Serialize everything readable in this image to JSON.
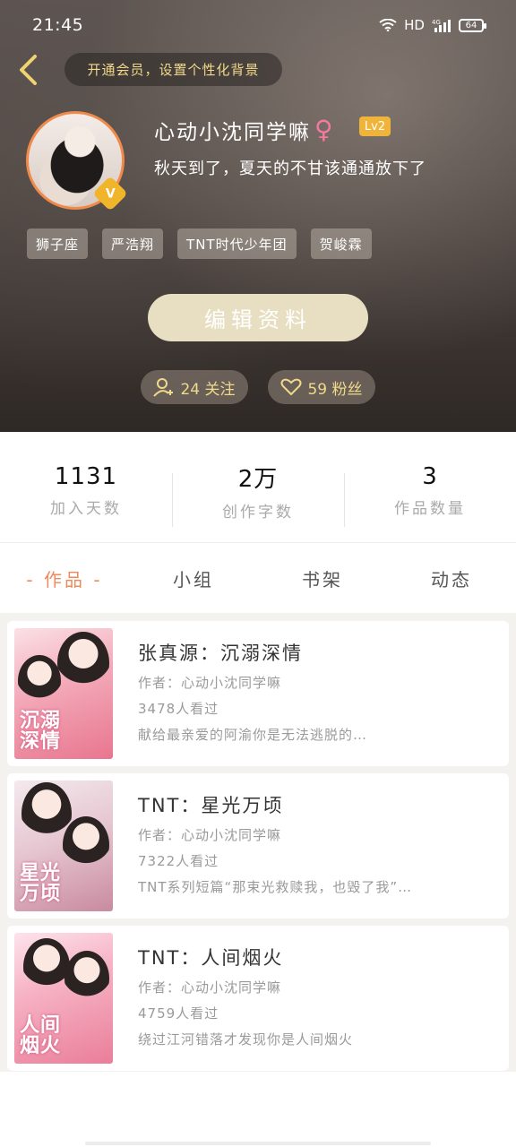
{
  "status_bar": {
    "time": "21:45",
    "network": "HD",
    "signal_type": "4G",
    "battery": "64"
  },
  "header": {
    "promo_text": "开通会员，设置个性化背景",
    "nickname": "心动小沈同学嘛",
    "gender_symbol": "♀",
    "level": "Lv2",
    "vip_mark": "V",
    "signature": "秋天到了，夏天的不甘该通通放下了",
    "tags": [
      "狮子座",
      "严浩翔",
      "TNT时代少年团",
      "贺峻霖"
    ],
    "edit_label": "编辑资料",
    "follow_text": "24 关注",
    "fans_text": "59 粉丝"
  },
  "stats": [
    {
      "value": "1131",
      "label": "加入天数"
    },
    {
      "value": "2万",
      "label": "创作字数"
    },
    {
      "value": "3",
      "label": "作品数量"
    }
  ],
  "tabs": [
    {
      "label": "- 作品 -",
      "active": true
    },
    {
      "label": "小组",
      "active": false
    },
    {
      "label": "书架",
      "active": false
    },
    {
      "label": "动态",
      "active": false
    }
  ],
  "works": [
    {
      "title": "张真源：沉溺深情",
      "author": "作者：心动小沈同学嘛",
      "views": "3478人看过",
      "desc": "献给最亲爱的阿渝你是无法逃脱的…",
      "cover_text": "沉溺\n深情"
    },
    {
      "title": "TNT：星光万顷",
      "author": "作者：心动小沈同学嘛",
      "views": "7322人看过",
      "desc": "TNT系列短篇“那束光救赎我，也毁了我”…",
      "cover_text": "星光\n万顷"
    },
    {
      "title": "TNT：人间烟火",
      "author": "作者：心动小沈同学嘛",
      "views": "4759人看过",
      "desc": "绕过江河错落才发现你是人间烟火",
      "cover_text": "人间\n烟火"
    }
  ],
  "colors": {
    "accent": "#f0895a",
    "gold": "#f0d98a",
    "edit_button": "#e8dfc2",
    "level_badge": "#f0b43a"
  }
}
